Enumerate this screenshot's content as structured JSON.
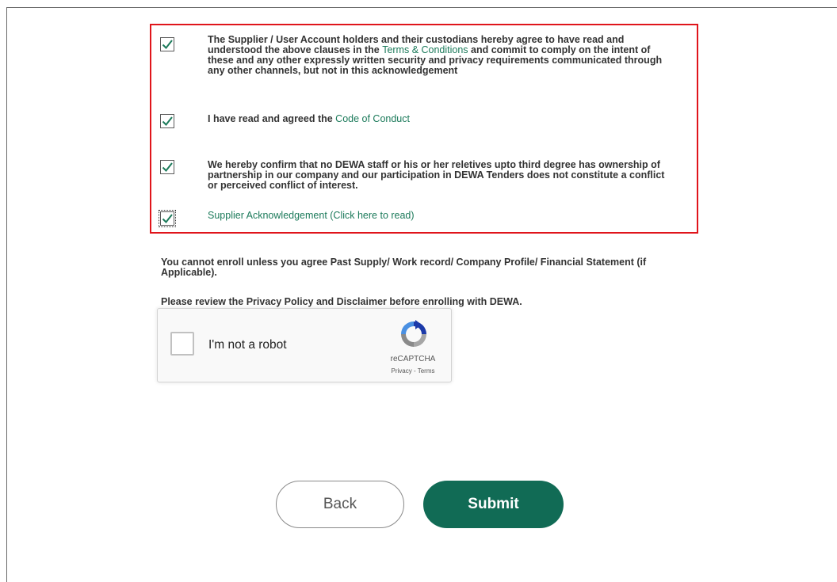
{
  "acknowledgements": [
    {
      "checked": true,
      "text_before": "The Supplier / User Account holders and their custodians hereby agree to have read and understood the above clauses in the ",
      "link": "Terms & Conditions",
      "text_after": " and commit to comply on the intent of these and any other expressly written security and privacy requirements communicated through any other channels, but not in this acknowledgement"
    },
    {
      "checked": true,
      "text_before": "I have read and agreed the ",
      "link": "Code of Conduct",
      "text_after": ""
    },
    {
      "checked": true,
      "text_before": "We hereby confirm that no DEWA staff or his or her reletives upto third degree has ownership of partnership in our company and our participation in DEWA Tenders does not constitute a conflict or perceived conflict of interest.",
      "link": "",
      "text_after": ""
    },
    {
      "checked": true,
      "text_before": "",
      "link": "Supplier Acknowledgement (Click here to read)",
      "text_after": ""
    }
  ],
  "notices": {
    "enroll": "You cannot enroll unless you agree Past Supply/ Work record/ Company Profile/ Financial Statement (if Applicable).",
    "privacy": "Please review the Privacy Policy and Disclaimer before enrolling with DEWA."
  },
  "captcha": {
    "label": "I'm not a robot",
    "brand": "reCAPTCHA",
    "links": "Privacy - Terms",
    "checked": false
  },
  "buttons": {
    "back": "Back",
    "submit": "Submit"
  },
  "colors": {
    "accent": "#116b55",
    "link": "#1b7a5a",
    "highlight_border": "#e0151b"
  }
}
